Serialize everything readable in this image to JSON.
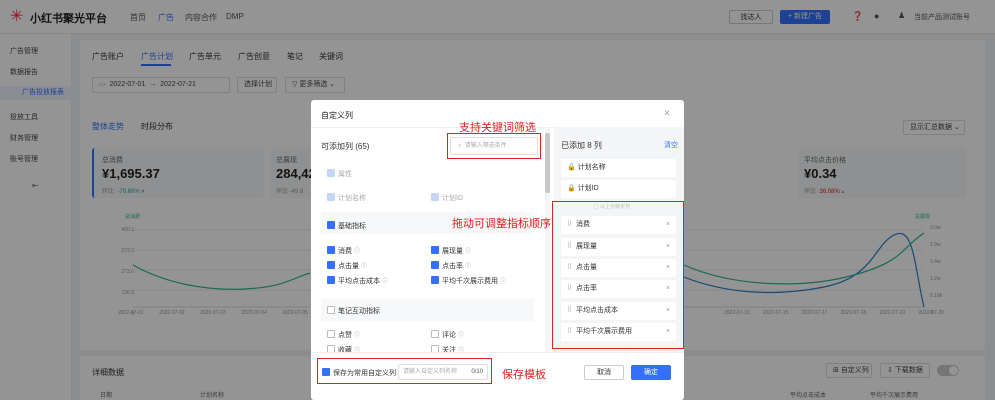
{
  "app": {
    "logo_text": "小红书聚光平台",
    "nav": [
      "首页",
      "广告",
      "内容合作",
      "DMP"
    ],
    "active_nav": "广告",
    "find_talent": "找达人",
    "new_ad": "+ 新建广告",
    "account": "当前产品测试账号"
  },
  "sidebar": {
    "items": [
      "广告管理",
      "数据报告",
      "广告投放报表",
      "投放工具",
      "财务管理",
      "账号管理"
    ]
  },
  "main": {
    "tabs": [
      "广告账户",
      "广告计划",
      "广告单元",
      "广告创意",
      "笔记",
      "关键词"
    ],
    "date_start": "2022-07-01",
    "date_end": "2022-07-21",
    "select_plan": "选择计划",
    "more_filter": "更多筛选",
    "sub_tabs": [
      "整体走势",
      "时段分布"
    ],
    "summary_select": "显示汇总数据",
    "cards": [
      {
        "label": "总消费",
        "value": "¥1,695.37",
        "compare": "环比",
        "change": "-79.66%"
      },
      {
        "label": "总展现",
        "value": "284,42",
        "compare": "环比",
        "change": "-49.6"
      },
      {
        "label": "平均点击价格",
        "value": "¥0.34",
        "compare": "环比",
        "change": "36.08%"
      }
    ],
    "chart_y_left": [
      "400.1",
      "273.2",
      "273.0",
      "136.6",
      "0"
    ],
    "chart_y_right": [
      "3.0w",
      "1.9w",
      "1.4w",
      "1.2w",
      "0.10k",
      "0"
    ],
    "chart_legend_left": "总消费",
    "chart_legend_right": "总展现",
    "chart_x_left": [
      "2022-07-01",
      "2022-07-02",
      "2022-07-03",
      "2022-07-04",
      "2022-07-05"
    ],
    "chart_x_right": [
      "2022-07-13",
      "2022-07-15",
      "2022-07-17",
      "2022-07-18",
      "2022-07-19",
      "2022-07-20"
    ],
    "detail_title": "详细数据",
    "custom_columns": "自定义列",
    "download": "下载数据",
    "table_cols": [
      "日期",
      "计划名称"
    ],
    "table_cols_right": [
      "平均点击成本",
      "平均千次展示费用"
    ]
  },
  "modal": {
    "title": "自定义列",
    "available_label": "可添加列 (65)",
    "search_placeholder": "请输入筛选条件",
    "attr_group": "属性",
    "attr_items": [
      "计划名称",
      "计划ID"
    ],
    "basic_group": "基础指标",
    "basic_items": [
      "消费",
      "展现量",
      "点击量",
      "点击率",
      "平均点击成本",
      "平均千次展示费用"
    ],
    "note_group": "笔记互动指标",
    "note_items": [
      "点赞",
      "评论",
      "收藏",
      "关注"
    ],
    "selected_label": "已添加 8 列",
    "clear": "清空",
    "fixed_items": [
      "计划名称",
      "计划ID"
    ],
    "fixed_hint": "以上为锁定列",
    "selected_items": [
      "消费",
      "展现量",
      "点击量",
      "点击率",
      "平均点击成本",
      "平均千次展示费用"
    ],
    "save_template": "保存为常用自定义列",
    "template_placeholder": "请输入自定义列名称",
    "template_count": "0/10",
    "cancel": "取消",
    "confirm": "确定"
  },
  "annotations": {
    "search": "支持关键词筛选",
    "drag": "拖动可调整指标顺序",
    "save": "保存模板"
  },
  "colors": {
    "accent": "#3370ff",
    "annotation": "#e02020",
    "chart_left": "#2bb596",
    "chart_right": "#2a7fc9"
  }
}
